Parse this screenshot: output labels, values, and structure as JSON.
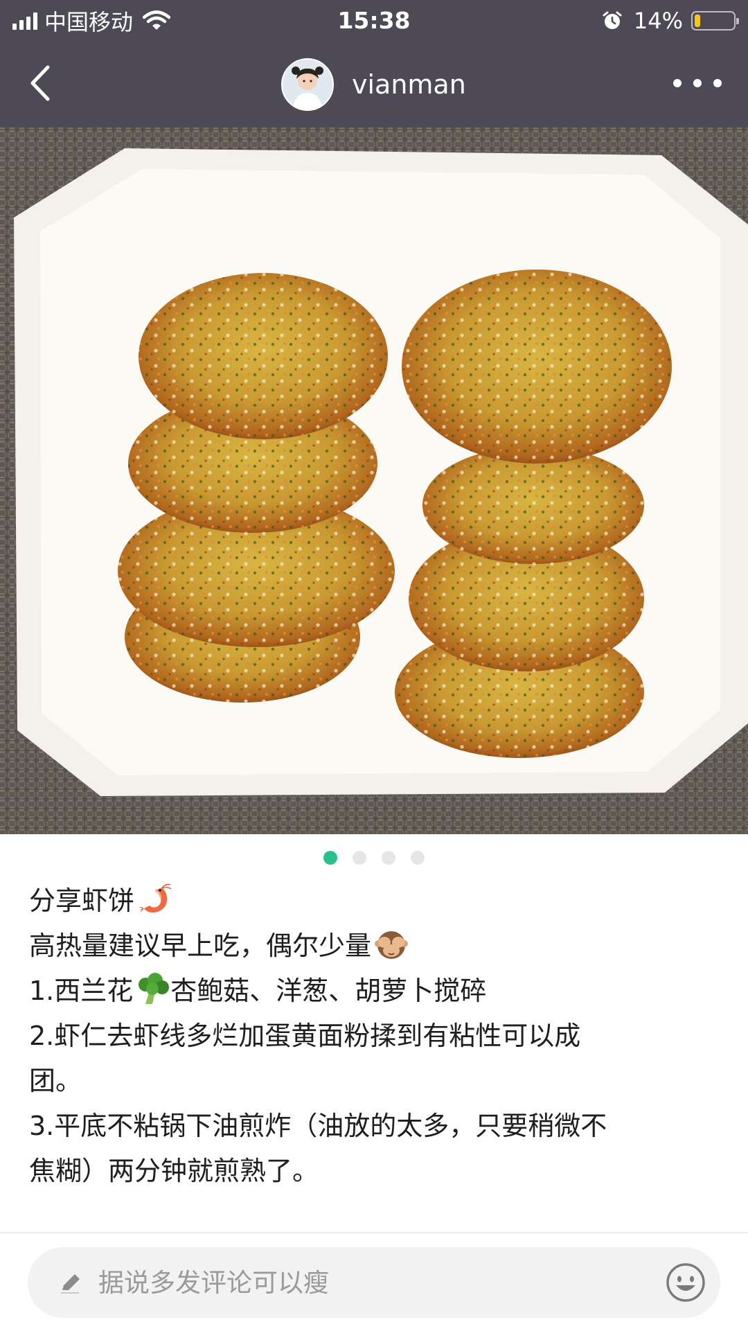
{
  "status_bar": {
    "carrier": "中国移动",
    "time": "15:38",
    "battery_percent": "14%",
    "battery_level": 0.14,
    "icons": [
      "signal-icon",
      "wifi-icon",
      "alarm-icon",
      "battery-icon"
    ]
  },
  "nav": {
    "username": "vianman",
    "icons": [
      "back-arrow-icon",
      "avatar",
      "more-dots-icon"
    ]
  },
  "carousel": {
    "current_page": 1,
    "total_pages": 4
  },
  "post": {
    "lines": [
      "分享虾饼",
      "高热量建议早上吃，偶尔少量",
      "1.西兰花",
      "杏鲍菇、洋葱、胡萝卜搅碎",
      "2.虾仁去虾线多烂加蛋黄面粉揉到有粘性可以成",
      "团。",
      "3.平底不粘锅下油煎炸（油放的太多，只要稍微不",
      "焦糊）两分钟就煎熟了。"
    ],
    "emoji": [
      "shrimp-emoji",
      "see-no-evil-monkey-emoji",
      "broccoli-emoji"
    ]
  },
  "comment": {
    "placeholder": "据说多发评论可以瘦",
    "icons": [
      "pencil-icon",
      "smiley-icon"
    ]
  },
  "colors": {
    "header_bg": "#4d4957",
    "active_dot": "#29c18b",
    "battery_fill": "#f5c518"
  }
}
